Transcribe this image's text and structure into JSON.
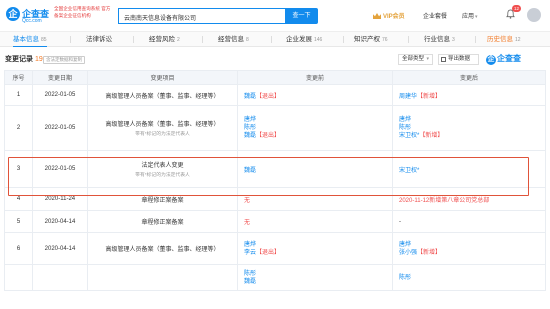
{
  "header": {
    "brand_name": "企查查",
    "brand_url": "Qcc.com",
    "slogan": "全国企业信用查询系统 官方备案企业征信机构",
    "search_value": "云南南天信息设备有限公司",
    "search_button": "查一下",
    "vip_label": "VIP会员",
    "nav": [
      {
        "label": "企业套餐"
      },
      {
        "label": "应用"
      }
    ],
    "notification_count": "12"
  },
  "tabs": [
    {
      "label": "基本信息",
      "count": "85",
      "active": true
    },
    {
      "label": "法律诉讼",
      "count": ""
    },
    {
      "label": "经营风险",
      "count": "2"
    },
    {
      "label": "经营信息",
      "count": "8"
    },
    {
      "label": "企业发展",
      "count": "146"
    },
    {
      "label": "知识产权",
      "count": "76"
    },
    {
      "label": "行业信息",
      "count": "3"
    },
    {
      "label": "历史信息",
      "count": "12"
    }
  ],
  "section": {
    "title": "变更记录",
    "count": "19",
    "note": "含法定数据和复制",
    "filter_label": "全部类型",
    "export_label": "导出数据",
    "brand": "企查查"
  },
  "table": {
    "columns": [
      "序号",
      "变更日期",
      "变更项目",
      "变更前",
      "变更后"
    ],
    "rows": [
      {
        "idx": "1",
        "date": "2022-01-05",
        "item": "高级管理人员备案（董事、监事、经理等）",
        "item_sub": "",
        "before": [
          "魏磊【退出】"
        ],
        "after": [
          "周建华【新增】"
        ]
      },
      {
        "idx": "2",
        "date": "2022-01-05",
        "item": "高级管理人员备案（董事、监事、经理等）",
        "item_sub": "带有*标记的为法定代表人",
        "before": [
          "唐烨",
          "陈彤",
          "魏磊【退出】"
        ],
        "after": [
          "唐烨",
          "陈彤",
          "宋卫权*【新增】"
        ]
      },
      {
        "idx": "3",
        "date": "2022-01-05",
        "item": "法定代表人变更",
        "item_sub": "带有*标记的为法定代表人",
        "before": [
          "魏磊"
        ],
        "after": [
          "宋卫权*"
        ]
      },
      {
        "idx": "4",
        "date": "2020-11-24",
        "item": "章程修正案备案",
        "item_sub": "",
        "before": [
          "无"
        ],
        "after": [
          "2020-11-12新增第八章公司党总部"
        ]
      },
      {
        "idx": "5",
        "date": "2020-04-14",
        "item": "章程修正案备案",
        "item_sub": "",
        "before": [
          "无"
        ],
        "after": [
          "-"
        ]
      },
      {
        "idx": "6",
        "date": "2020-04-14",
        "item": "高级管理人员备案（董事、监事、经理等）",
        "item_sub": "",
        "before": [
          "唐烨",
          "李云【退出】"
        ],
        "after": [
          "唐烨",
          "张小强【新增】"
        ]
      },
      {
        "idx": "",
        "date": "",
        "item": "",
        "item_sub": "",
        "before": [
          "陈彤",
          "魏磊"
        ],
        "after": [
          "陈彤"
        ]
      }
    ]
  },
  "colors": {
    "accent": "#128bed",
    "highlight": "#e0533a",
    "history": "#f27a27"
  }
}
